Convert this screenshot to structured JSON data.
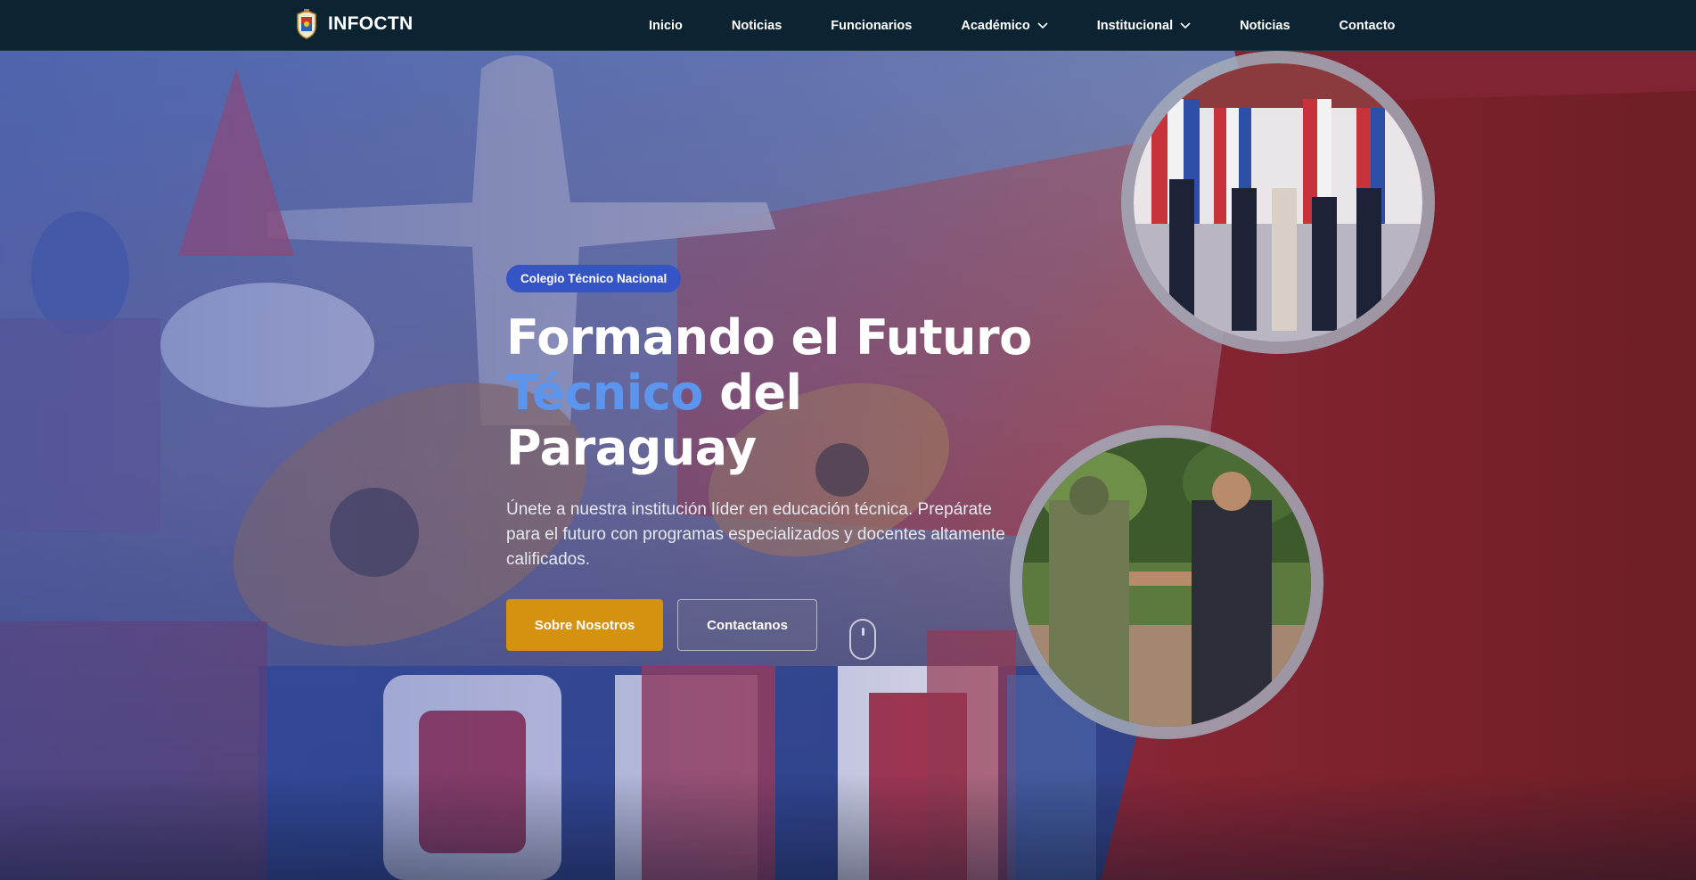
{
  "brand": {
    "name": "INFOCTN",
    "logo_icon": "school-crest-icon"
  },
  "nav": {
    "items": [
      {
        "label": "Inicio",
        "dropdown": false
      },
      {
        "label": "Noticias",
        "dropdown": false
      },
      {
        "label": "Funcionarios",
        "dropdown": false
      },
      {
        "label": "Académico",
        "dropdown": true
      },
      {
        "label": "Institucional",
        "dropdown": true
      },
      {
        "label": "Noticias",
        "dropdown": false
      },
      {
        "label": "Contacto",
        "dropdown": false
      }
    ]
  },
  "hero": {
    "badge": "Colegio Técnico Nacional",
    "title_line1": "Formando el Futuro",
    "title_accent": "Técnico",
    "title_rest": " del Paraguay",
    "description": "Únete a nuestra institución líder en educación técnica. Prepárate para el futuro con programas especializados y docentes altamente calificados.",
    "primary_button": "Sobre Nosotros",
    "secondary_button": "Contactanos"
  },
  "colors": {
    "navbar": "#0c2431",
    "badge": "#3554c5",
    "accent_text": "#5c95ee",
    "primary_button": "#d59110",
    "hero_right": "#7a2030"
  }
}
